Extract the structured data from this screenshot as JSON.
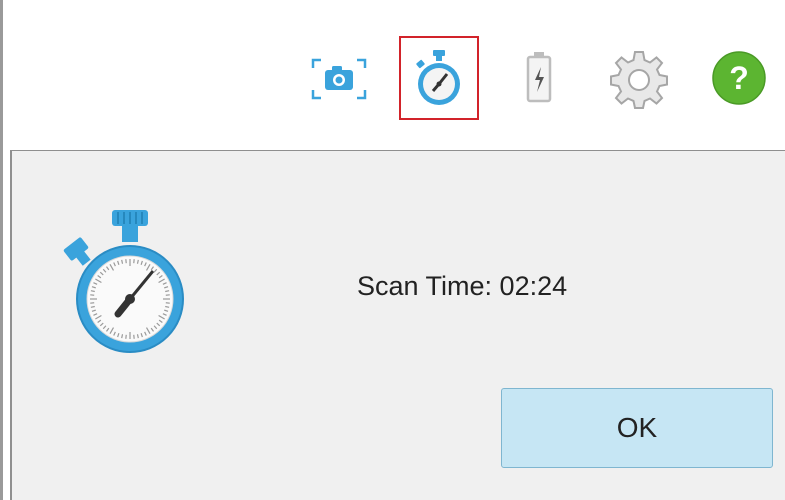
{
  "toolbar": {
    "buttons": [
      {
        "icon": "camera-capture-icon",
        "selected": false
      },
      {
        "icon": "stopwatch-icon",
        "selected": true
      },
      {
        "icon": "battery-icon",
        "selected": false
      },
      {
        "icon": "gear-icon",
        "selected": false
      },
      {
        "icon": "help-icon",
        "selected": false,
        "glyph": "?"
      }
    ],
    "selected_color": "#d2232a"
  },
  "dialog": {
    "icon": "stopwatch-icon",
    "message": "Scan Time: 02:24",
    "ok_label": "OK"
  },
  "colors": {
    "accent_blue": "#3aa3dc",
    "help_green": "#5cb531",
    "ok_button_bg": "#c6e6f4",
    "dialog_bg": "#f0f0f0"
  }
}
